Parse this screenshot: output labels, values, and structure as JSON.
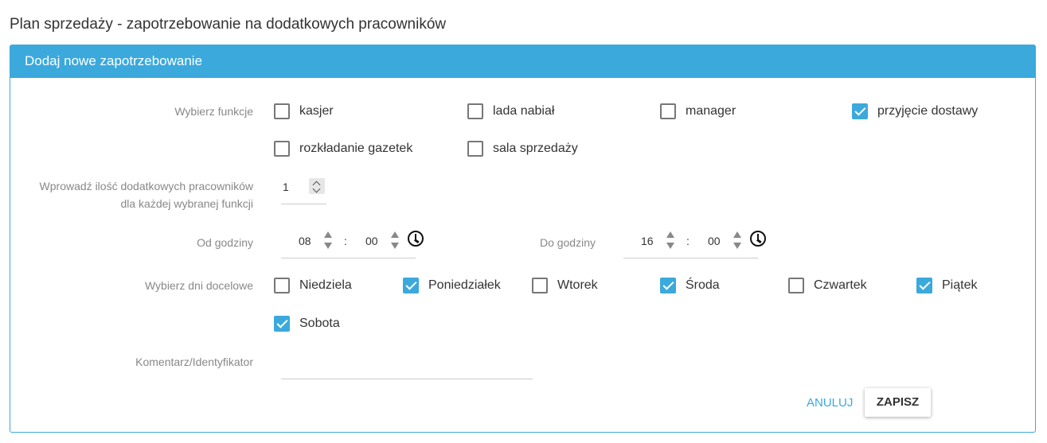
{
  "page": {
    "title": "Plan sprzedaży - zapotrzebowanie na dodatkowych pracowników"
  },
  "panel": {
    "header": "Dodaj nowe zapotrzebowanie"
  },
  "colors": {
    "accent": "#3ba9dc",
    "checkbox_border": "#777777",
    "label": "#888888"
  },
  "functions": {
    "label": "Wybierz funkcje",
    "items": [
      {
        "label": "kasjer",
        "checked": false
      },
      {
        "label": "lada nabiał",
        "checked": false
      },
      {
        "label": "manager",
        "checked": false
      },
      {
        "label": "przyjęcie dostawy",
        "checked": true
      },
      {
        "label": "rozkładanie gazetek",
        "checked": false
      },
      {
        "label": "sala sprzedaży",
        "checked": false
      }
    ]
  },
  "workers": {
    "label_line1": "Wprowadź ilość dodatkowych pracowników",
    "label_line2": "dla każdej wybranej funkcji",
    "value": "1"
  },
  "from_time": {
    "label": "Od godziny",
    "hours": "08",
    "minutes": "00",
    "icon": "clock-icon"
  },
  "to_time": {
    "label": "Do godziny",
    "hours": "16",
    "minutes": "00",
    "icon": "clock-icon"
  },
  "time_separator": ":",
  "days": {
    "label": "Wybierz dni docelowe",
    "items": [
      {
        "label": "Niedziela",
        "checked": false
      },
      {
        "label": "Poniedziałek",
        "checked": true
      },
      {
        "label": "Wtorek",
        "checked": false
      },
      {
        "label": "Środa",
        "checked": true
      },
      {
        "label": "Czwartek",
        "checked": false
      },
      {
        "label": "Piątek",
        "checked": true
      },
      {
        "label": "Sobota",
        "checked": true
      }
    ]
  },
  "comment": {
    "label": "Komentarz/Identyfikator",
    "value": ""
  },
  "actions": {
    "cancel": "ANULUJ",
    "save": "ZAPISZ"
  }
}
